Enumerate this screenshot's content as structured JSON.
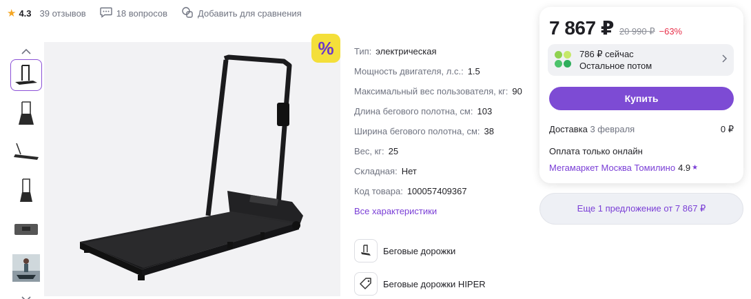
{
  "header": {
    "rating": "4.3",
    "reviews": "39 отзывов",
    "questions": "18 вопросов",
    "compare": "Добавить для сравнения"
  },
  "gallery": {
    "thumbnail_count": 6,
    "active_thumbnail": 1
  },
  "promo_badge": "%",
  "specs": [
    {
      "key": "Тип:",
      "value": "электрическая"
    },
    {
      "key": "Мощность двигателя, л.с.:",
      "value": "1.5"
    },
    {
      "key": "Максимальный вес пользователя, кг:",
      "value": "90"
    },
    {
      "key": "Длина бегового полотна, см:",
      "value": "103"
    },
    {
      "key": "Ширина бегового полотна, см:",
      "value": "38"
    },
    {
      "key": "Вес, кг:",
      "value": "25"
    },
    {
      "key": "Складная:",
      "value": "Нет"
    },
    {
      "key": "Код товара:",
      "value": "100057409367"
    }
  ],
  "all_specs_link": "Все характеристики",
  "categories": [
    {
      "label": "Беговые дорожки",
      "icon": "treadmill-icon"
    },
    {
      "label": "Беговые дорожки HIPER",
      "icon": "tag-icon"
    }
  ],
  "price_card": {
    "price": "7 867 ₽",
    "old_price": "20 990 ₽",
    "discount": "−63%",
    "split_now": "786 ₽ сейчас",
    "split_rest": "Остальное потом",
    "buy_label": "Купить",
    "delivery_label": "Доставка",
    "delivery_date": "3 февраля",
    "delivery_price": "0 ₽",
    "payment_note": "Оплата только онлайн",
    "seller_name": "Мегамаркет Москва Томилино",
    "seller_rating": "4.9"
  },
  "more_offers": "Еще 1 предложение от 7 867 ₽",
  "colors": {
    "accent": "#7d4bd4",
    "link": "#7a3ed6",
    "discount": "#e8304a",
    "star": "#f5a623",
    "promo": "#f4df3a"
  }
}
